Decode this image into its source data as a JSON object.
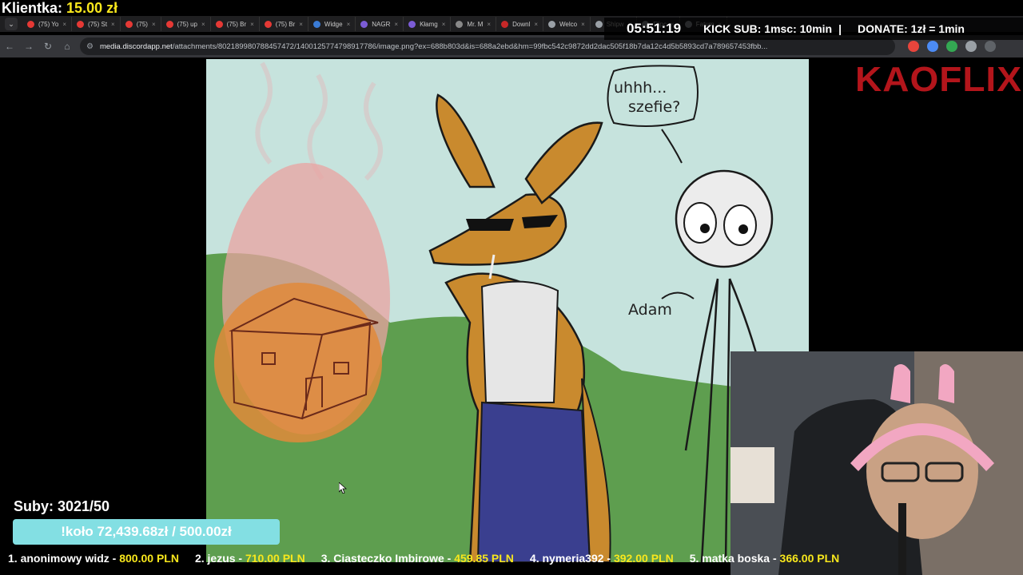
{
  "overlay": {
    "title_label": "Klientka:",
    "title_amount": "15.00 zł",
    "clock": "05:51:19",
    "kick_sub": "KICK SUB: 1msc: 10min",
    "separator": "|",
    "donate": "DONATE: 1zł = 1min",
    "brand": "KAOFLIX",
    "subs": "Suby: 3021/50",
    "goal": "!koło 72,439.68zł / 500.00zł"
  },
  "tabs": [
    {
      "label": "(75) Yo",
      "color": "#e53935"
    },
    {
      "label": "(75) St",
      "color": "#e53935"
    },
    {
      "label": "(75)",
      "color": "#e53935"
    },
    {
      "label": "(75) up",
      "color": "#e53935"
    },
    {
      "label": "(75) Br",
      "color": "#e53935"
    },
    {
      "label": "(75) Br",
      "color": "#e53935"
    },
    {
      "label": "Widge",
      "color": "#3a7bd5"
    },
    {
      "label": "NAGR",
      "color": "#7b5cd6"
    },
    {
      "label": "Kłamg",
      "color": "#7b5cd6"
    },
    {
      "label": "Mr. M",
      "color": "#888888"
    },
    {
      "label": "Downl",
      "color": "#c62828"
    },
    {
      "label": "Welco",
      "color": "#9aa0a6"
    },
    {
      "label": "Shipw",
      "color": "#9aa0a6"
    },
    {
      "label": "Flipc",
      "color": "#9aa0a6"
    },
    {
      "label": "Fatum",
      "color": "#9aa0a6"
    }
  ],
  "address": {
    "host": "media.discordapp.net",
    "path": "/attachments/802189980788457472/1400125774798917786/image.png?ex=688b803d&is=688a2ebd&hm=99fbc542c9872dd2dac505f18b7da12c4d5b5893cd7a789657453fbb..."
  },
  "drawing": {
    "speech_line1": "uhhh...",
    "speech_line2": "szefie?",
    "name_label": "Adam"
  },
  "leaderboard": [
    {
      "name": "1. anonimowy widz - ",
      "amount": "800.00 PLN"
    },
    {
      "name": "2. jezus - ",
      "amount": "710.00 PLN"
    },
    {
      "name": "3. Ciasteczko Imbirowe - ",
      "amount": "459.85 PLN"
    },
    {
      "name": "4. nymeria392 - ",
      "amount": "392.00 PLN"
    },
    {
      "name": "5. matka boska - ",
      "amount": "366.00 PLN"
    }
  ]
}
